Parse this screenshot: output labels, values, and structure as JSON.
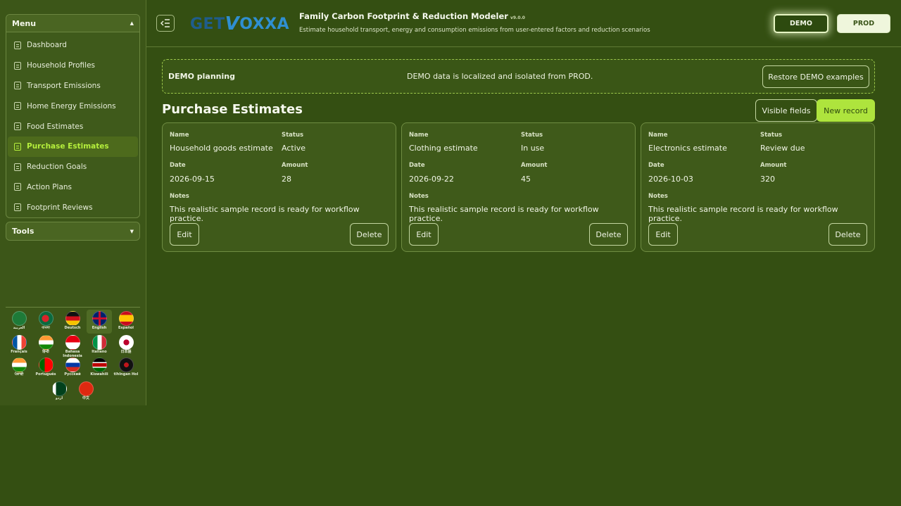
{
  "sidebar": {
    "menu_title": "Menu",
    "tools_title": "Tools",
    "items": [
      {
        "label": "Dashboard"
      },
      {
        "label": "Household Profiles"
      },
      {
        "label": "Transport Emissions"
      },
      {
        "label": "Home Energy Emissions"
      },
      {
        "label": "Food Estimates"
      },
      {
        "label": "Purchase Estimates",
        "active": true
      },
      {
        "label": "Reduction Goals"
      },
      {
        "label": "Action Plans"
      },
      {
        "label": "Footprint Reviews"
      }
    ],
    "languages": [
      {
        "label": "العربية"
      },
      {
        "label": "বাংলা"
      },
      {
        "label": "Deutsch"
      },
      {
        "label": "English",
        "selected": true
      },
      {
        "label": "Español"
      },
      {
        "label": "Français"
      },
      {
        "label": "हिन्दी"
      },
      {
        "label": "Bahasa Indonesia"
      },
      {
        "label": "Italiano"
      },
      {
        "label": "日本語"
      },
      {
        "label": "ਪੰਜਾਬੀ"
      },
      {
        "label": "Português"
      },
      {
        "label": "Русский"
      },
      {
        "label": "Kiswahili"
      },
      {
        "label": "tlhIngan Hol"
      },
      {
        "label": "اردو"
      },
      {
        "label": "中文"
      }
    ]
  },
  "header": {
    "logo_part1": "GET",
    "logo_part2": "V",
    "logo_part3": "OXXA",
    "title": "Family Carbon Footprint & Reduction Modeler",
    "version": "v9.0.0",
    "subtitle": "Estimate household transport, energy and consumption emissions from user-entered factors and reduction scenarios",
    "demo_label": "DEMO",
    "prod_label": "PROD"
  },
  "banner": {
    "title": "DEMO planning",
    "message": "DEMO data is localized and isolated from PROD.",
    "restore_label": "Restore DEMO examples"
  },
  "main": {
    "title": "Purchase Estimates",
    "visible_fields_label": "Visible fields",
    "new_record_label": "New record",
    "field_labels": {
      "name": "Name",
      "status": "Status",
      "date": "Date",
      "amount": "Amount",
      "notes": "Notes"
    },
    "edit_label": "Edit",
    "delete_label": "Delete",
    "records": [
      {
        "name": "Household goods estimate",
        "status": "Active",
        "date": "2026-09-15",
        "amount": "28",
        "notes": "This realistic sample record is ready for workflow practice."
      },
      {
        "name": "Clothing estimate",
        "status": "In use",
        "date": "2026-09-22",
        "amount": "45",
        "notes": "This realistic sample record is ready for workflow practice."
      },
      {
        "name": "Electronics estimate",
        "status": "Review due",
        "date": "2026-10-03",
        "amount": "320",
        "notes": "This realistic sample record is ready for workflow practice."
      }
    ]
  },
  "colors": {
    "background": "#344f12",
    "accent": "#aee43d",
    "active_menu_text": "#b5ef3c",
    "logo_blue": "#2f8fd1"
  }
}
